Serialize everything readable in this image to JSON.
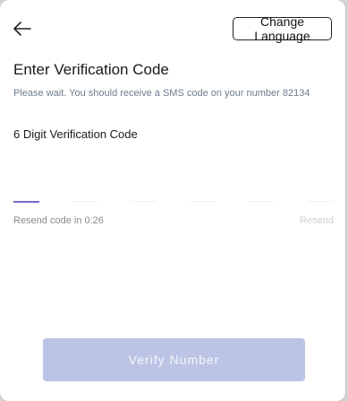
{
  "header": {
    "back_icon": "arrow-left-icon",
    "change_language_label": "Change Language"
  },
  "main": {
    "title": "Enter Verification Code",
    "subtitle": "Please wait. You should receive a SMS code on your number 82134",
    "code_label": "6 Digit Verification Code",
    "digits": [
      "",
      "",
      "",
      "",
      "",
      ""
    ],
    "active_digit_index": 0,
    "resend_timer": "Resend code in 0:26",
    "resend_label": "Resend"
  },
  "footer": {
    "verify_label": "Verify Number"
  },
  "colors": {
    "accent": "#7b68c8",
    "verify_button_bg": "#bcc4e6",
    "subtitle_text": "#6c7c8c",
    "resend_disabled": "#d0d0d0"
  }
}
